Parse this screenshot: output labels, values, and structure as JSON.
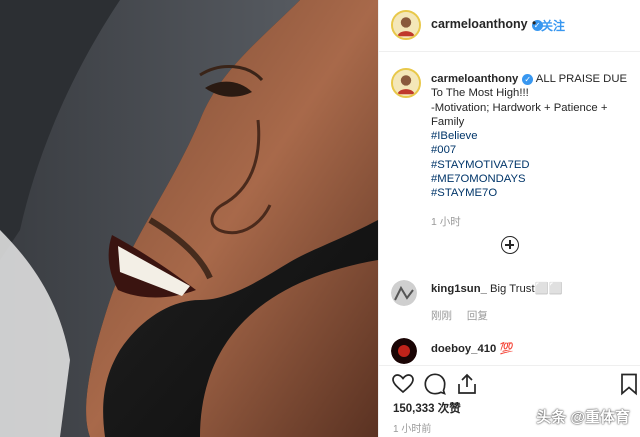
{
  "header": {
    "username": "carmeloanthony",
    "verified_mark": "✓",
    "separator": "•",
    "follow_label": "关注"
  },
  "caption": {
    "username": "carmeloanthony",
    "lines": [
      "ALL PRAISE DUE To The Most High!!!",
      "-Motivation; Hardwork + Patience + Family"
    ],
    "hashtags": [
      "#IBelieve",
      "#007",
      "#STAYMOTIVA7ED",
      "#ME7OMONDAYS",
      "#STAYME7O"
    ],
    "time": "1 小时"
  },
  "load_more": {
    "icon": "plus-circle-icon"
  },
  "comments": [
    {
      "username": "king1sun_",
      "text": "Big Trust⬜⬜",
      "meta_time": "刚刚",
      "meta_reply": "回复"
    },
    {
      "username": "doeboy_410",
      "text": "💯"
    }
  ],
  "actions": {
    "like_icon": "heart-icon",
    "comment_icon": "comment-icon",
    "share_icon": "share-icon",
    "save_icon": "bookmark-icon"
  },
  "likes_text": "150,333 次赞",
  "post_time": "1 小时前",
  "watermark": "头条 @重体育",
  "colors": {
    "link_blue": "#3897f0",
    "hashtag": "#003569",
    "muted": "#999999",
    "avatar_ring": "#e8c84a"
  }
}
